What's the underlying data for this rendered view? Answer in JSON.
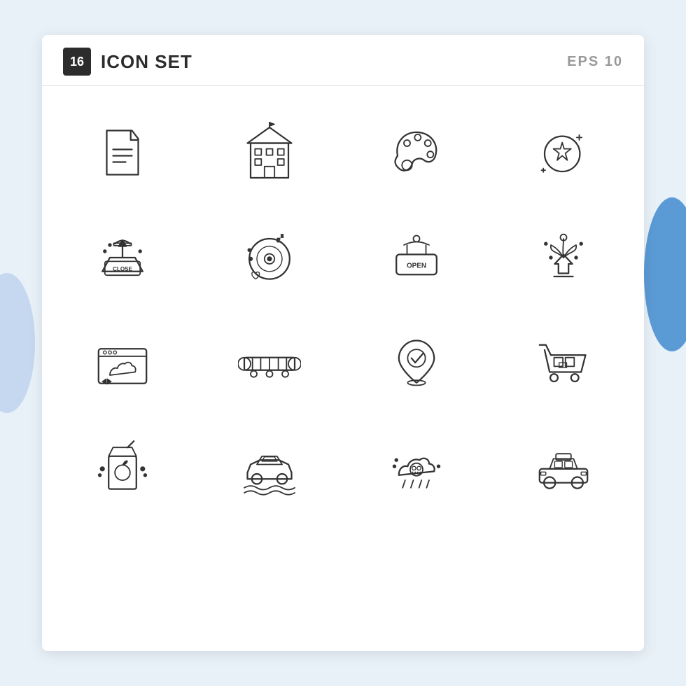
{
  "header": {
    "badge": "16",
    "title": "ICON SET",
    "format": "EPS 10"
  },
  "icons": [
    {
      "name": "document",
      "row": 1,
      "col": 1
    },
    {
      "name": "building",
      "row": 1,
      "col": 2
    },
    {
      "name": "palette",
      "row": 1,
      "col": 3
    },
    {
      "name": "sparkle-coin",
      "row": 1,
      "col": 4
    },
    {
      "name": "close-sign",
      "row": 2,
      "col": 1
    },
    {
      "name": "vinyl-record",
      "row": 2,
      "col": 2
    },
    {
      "name": "open-sign",
      "row": 2,
      "col": 3
    },
    {
      "name": "fleur-plant",
      "row": 2,
      "col": 4
    },
    {
      "name": "cloud-browser",
      "row": 3,
      "col": 1
    },
    {
      "name": "conveyor",
      "row": 3,
      "col": 2
    },
    {
      "name": "location-pin",
      "row": 3,
      "col": 3
    },
    {
      "name": "shopping-cart",
      "row": 3,
      "col": 4
    },
    {
      "name": "juice-box",
      "row": 4,
      "col": 1
    },
    {
      "name": "car-wash",
      "row": 4,
      "col": 2
    },
    {
      "name": "storm-skull",
      "row": 4,
      "col": 3
    },
    {
      "name": "taxi-car",
      "row": 4,
      "col": 4
    }
  ]
}
